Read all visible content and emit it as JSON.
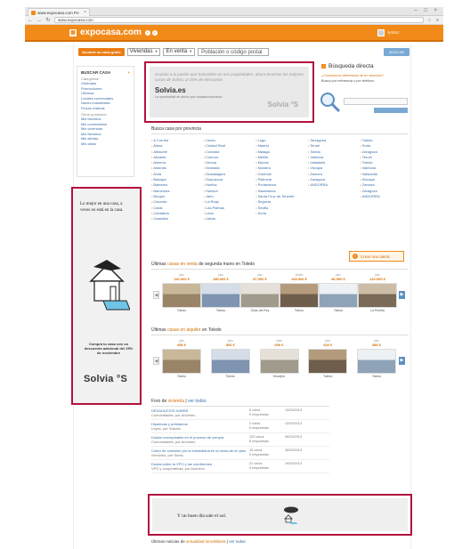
{
  "browser": {
    "tab_title": "www.expocasa.com Po",
    "url": "www.expocasa.com"
  },
  "header": {
    "logo_text": "expocasa.com",
    "account_label": "SANIJ"
  },
  "search": {
    "publish_btn": "Anuncie su casa gratis",
    "type_select": "Viviendas",
    "op_select": "En venta",
    "location_placeholder": "Población o código postal",
    "submit_btn": "BUSCAR"
  },
  "sidebar": {
    "title": "BUSCAR CASA",
    "categories_label": "Categorías",
    "items": [
      "Viviendas",
      "Promociones",
      "Oficinas",
      "Locales comerciales",
      "Naves industriales",
      "Fincas rústicas"
    ],
    "interest_label": "Otros productos",
    "interest_items": [
      "Mis favoritos",
      "Mis comentarios",
      "Mis viviendas",
      "Mis favoritos",
      "Mis alertas",
      "Mis datos"
    ]
  },
  "ad_top": {
    "text": "Gracias a la pasión que transmiten en sus propiedades, ahora tenemos las mejores casas de Solvia, al 25% de descuento",
    "brand": "Solvia.es",
    "tiny": "La oportunidad de ahorro que estabas buscando",
    "brand2": "Solvia"
  },
  "direct_search": {
    "title": "Búsqueda directa",
    "link": "¿Conoces la referencia de un anuncio?",
    "hint": "Busca por referencia o por teléfono"
  },
  "provinces": {
    "heading_prefix": "Busca casa por provincia",
    "columns": [
      [
        "A Coruña",
        "Álava",
        "Albacete",
        "Alicante",
        "Almería",
        "Asturias",
        "Ávila",
        "Badajoz",
        "Baleares",
        "Barcelona",
        "Burgos",
        "Cáceres",
        "Cádiz",
        "Cantabria",
        "Castellón"
      ],
      [
        "Ceuta",
        "Ciudad Real",
        "Córdoba",
        "Cuenca",
        "Girona",
        "Granada",
        "Guadalajara",
        "Guipúzcoa",
        "Huelva",
        "Huesca",
        "Jaén",
        "La Rioja",
        "Las Palmas",
        "León",
        "Lleida"
      ],
      [
        "Lugo",
        "Madrid",
        "Málaga",
        "Melilla",
        "Murcia",
        "Navarra",
        "Ourense",
        "Palencia",
        "Pontevedra",
        "Salamanca",
        "Santa Cruz de Tenerife",
        "Segovia",
        "Sevilla",
        "Soria"
      ],
      [
        "Tarragona",
        "Teruel",
        "Toledo",
        "Valencia",
        "Valladolid",
        "Vizcaya",
        "Zamora",
        "Zaragoza",
        "ANDORRA"
      ],
      [
        "Toledo",
        "Soria",
        "Zaragoza",
        "Teruel",
        "Toledo",
        "Valencia",
        "Valladolid",
        "Vizcaya",
        "Zamora",
        "Zaragoza",
        "ANDORRA"
      ]
    ],
    "alert_btn": "Crear una alerta"
  },
  "sales": {
    "heading_pre": "Últimas",
    "heading_hl": "casas en venta",
    "heading_post": "de segunda mano en Toledo",
    "cards": [
      {
        "lbl": "piso",
        "price": "142.000 €",
        "cap": "Toledo"
      },
      {
        "lbl": "piso",
        "price": "180.000 €",
        "cap": "Toledo"
      },
      {
        "lbl": "piso",
        "price": "87.000 €",
        "cap": "Olías del Rey"
      },
      {
        "lbl": "chalet",
        "price": "165.000 €",
        "cap": "Toledo"
      },
      {
        "lbl": "piso",
        "price": "96.000 €",
        "cap": "Toledo"
      },
      {
        "lbl": "piso",
        "price": "120.000 €",
        "cap": "La Puebla"
      }
    ]
  },
  "rent": {
    "heading_pre": "Últimas",
    "heading_hl": "casas en alquiler",
    "heading_post": "en Toledo",
    "cards": [
      {
        "lbl": "piso",
        "price": "450 €",
        "cap": "Toledo"
      },
      {
        "lbl": "piso",
        "price": "500 €",
        "cap": "Toledo"
      },
      {
        "lbl": "casa",
        "price": "600 €",
        "cap": "Mocejón"
      },
      {
        "lbl": "piso",
        "price": "420 €",
        "cap": "Toledo"
      },
      {
        "lbl": "piso",
        "price": "380 €",
        "cap": "Toledo"
      }
    ]
  },
  "forum": {
    "heading_pre": "Foro de",
    "heading_hl": "vivienda",
    "heading_post": "ver todos",
    "rows": [
      {
        "title": "DESAHUCIOS HABRÁ",
        "by": "Comunidades, por Anónimo",
        "stat1": "5 votos",
        "stat2": "0 respuestas",
        "last": "13/03/2013"
      },
      {
        "title": "Hipotecas y préstamos",
        "by": "Leyes, por Sakura",
        "stat1": "2 votos",
        "stat2": "0 respuestas",
        "last": "12/03/2013"
      },
      {
        "title": "Dudas conceptuales en el proceso de compra",
        "by": "Comunidades, por Anónimo",
        "stat1": "123 votos",
        "stat2": "8 respuestas",
        "last": "06/03/2013"
      },
      {
        "title": "Cobro de comisión por la inmobiliaria en la venta de un piso",
        "by": "Servicios, por Sonia",
        "stat1": "15 votos",
        "stat2": "0 respuestas",
        "last": "26/02/2013"
      },
      {
        "title": "Dudas sobre la VPO y las condiciones",
        "by": "VPO y cooperativas, por Anónimo",
        "stat1": "21 votos",
        "stat2": "3 respuestas",
        "last": "19/02/2013"
      }
    ]
  },
  "ad_left": {
    "slogan": "Lo mejor en una casa, a veces no está en la casa.",
    "foot": "Compra tu casa con un descuento adicional del 25% de noviembre",
    "brand": "Solvia"
  },
  "ad_bottom": {
    "msg": "Y un buen día sale el sol."
  },
  "tail": {
    "pre": "Últimas noticias de",
    "hl": "actualidad inmobiliaria",
    "bl": "ver todas"
  },
  "colors": {
    "brand_orange": "#f28a1a",
    "ad_border": "#b3123d",
    "link_blue": "#3a6da8"
  }
}
